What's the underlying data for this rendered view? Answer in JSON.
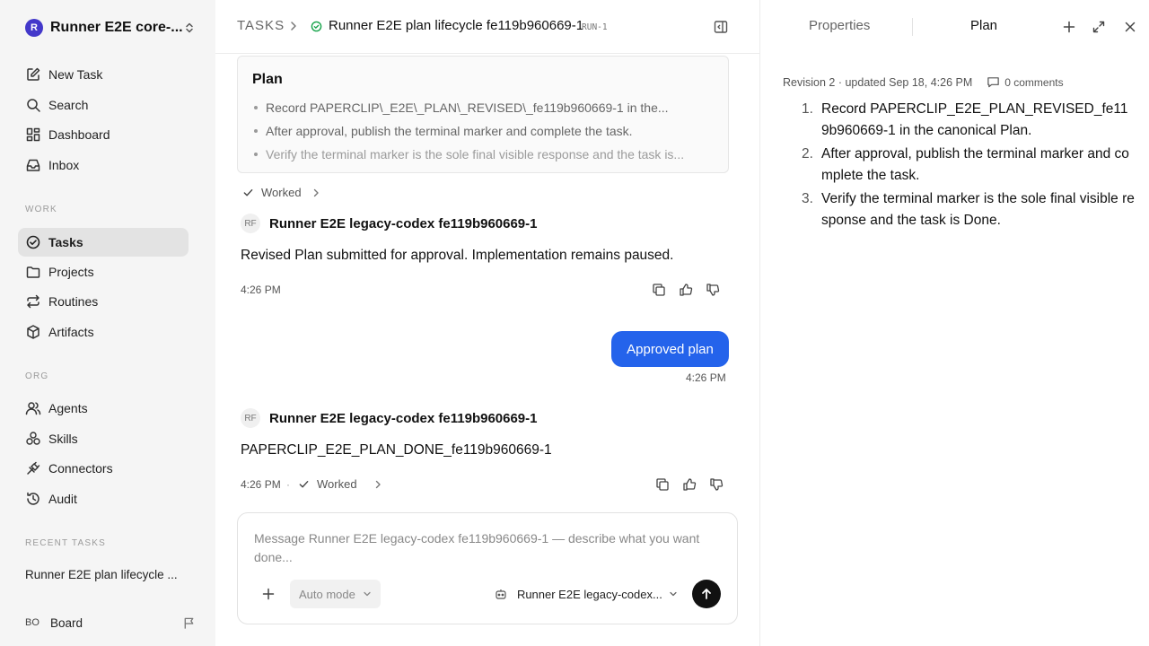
{
  "workspace": {
    "logo_letter": "R",
    "name": "Runner E2E core-..."
  },
  "sidebar": {
    "primary": [
      {
        "label": "New Task",
        "icon": "pencil-square-icon"
      },
      {
        "label": "Search",
        "icon": "search-icon"
      },
      {
        "label": "Dashboard",
        "icon": "dashboard-icon"
      },
      {
        "label": "Inbox",
        "icon": "inbox-icon"
      }
    ],
    "work_label": "WORK",
    "work": [
      {
        "label": "Tasks",
        "icon": "check-circle-icon",
        "active": true
      },
      {
        "label": "Projects",
        "icon": "folder-icon"
      },
      {
        "label": "Routines",
        "icon": "repeat-icon"
      },
      {
        "label": "Artifacts",
        "icon": "box-icon"
      }
    ],
    "org_label": "ORG",
    "org": [
      {
        "label": "Agents",
        "icon": "users-icon"
      },
      {
        "label": "Skills",
        "icon": "skills-icon"
      },
      {
        "label": "Connectors",
        "icon": "plug-icon"
      },
      {
        "label": "Audit",
        "icon": "history-icon"
      }
    ],
    "recent_label": "RECENT TASKS",
    "recent_task": "Runner E2E plan lifecycle ...",
    "user": {
      "initials": "BO",
      "name": "Board"
    }
  },
  "header": {
    "section": "TASKS",
    "task_title": "Runner E2E plan lifecycle fe119b960669-1",
    "run_badge": "RUN-1"
  },
  "thread": {
    "plan_card": {
      "title": "Plan",
      "items": [
        "Record PAPERCLIP\\_E2E\\_PLAN\\_REVISED\\_fe119b960669-1 in the...",
        "After approval, publish the terminal marker and complete the task.",
        "Verify the terminal marker is the sole final visible response and the task is..."
      ]
    },
    "worked_label": "Worked",
    "agent_initials": "RF",
    "agent_name": "Runner E2E legacy-codex fe119b960669-1",
    "message1": {
      "text": "Revised Plan submitted for approval. Implementation remains paused.",
      "time": "4:26 PM"
    },
    "user_message": {
      "text": "Approved plan",
      "time": "4:26 PM"
    },
    "message2": {
      "text": "PAPERCLIP_E2E_PLAN_DONE_fe119b960669-1",
      "time": "4:26 PM",
      "separator": "·"
    }
  },
  "composer": {
    "placeholder": "Message Runner E2E legacy-codex fe119b960669-1 — describe what you want done...",
    "mode_label": "Auto mode",
    "agent_label": "Runner E2E legacy-codex..."
  },
  "right_panel": {
    "tabs": [
      "Properties",
      "Plan"
    ],
    "active_tab": "Plan",
    "meta": "Revision 2 · updated Sep 18, 4:26 PM",
    "comments": "0 comments",
    "plan_items": [
      {
        "num": "1.",
        "text": "Record PAPERCLIP_E2E_PLAN_REVISED_fe119b960669-1 in the canonical Plan."
      },
      {
        "num": "2.",
        "text": "After approval, publish the terminal marker and complete the task."
      },
      {
        "num": "3.",
        "text": "Verify the terminal marker is the sole final visible response and the task is Done."
      }
    ]
  },
  "colors": {
    "accent": "#2463eb",
    "sidebar_bg": "#f5f5f5",
    "status_green": "#16a34a",
    "workspace_logo": "#4338ca"
  }
}
